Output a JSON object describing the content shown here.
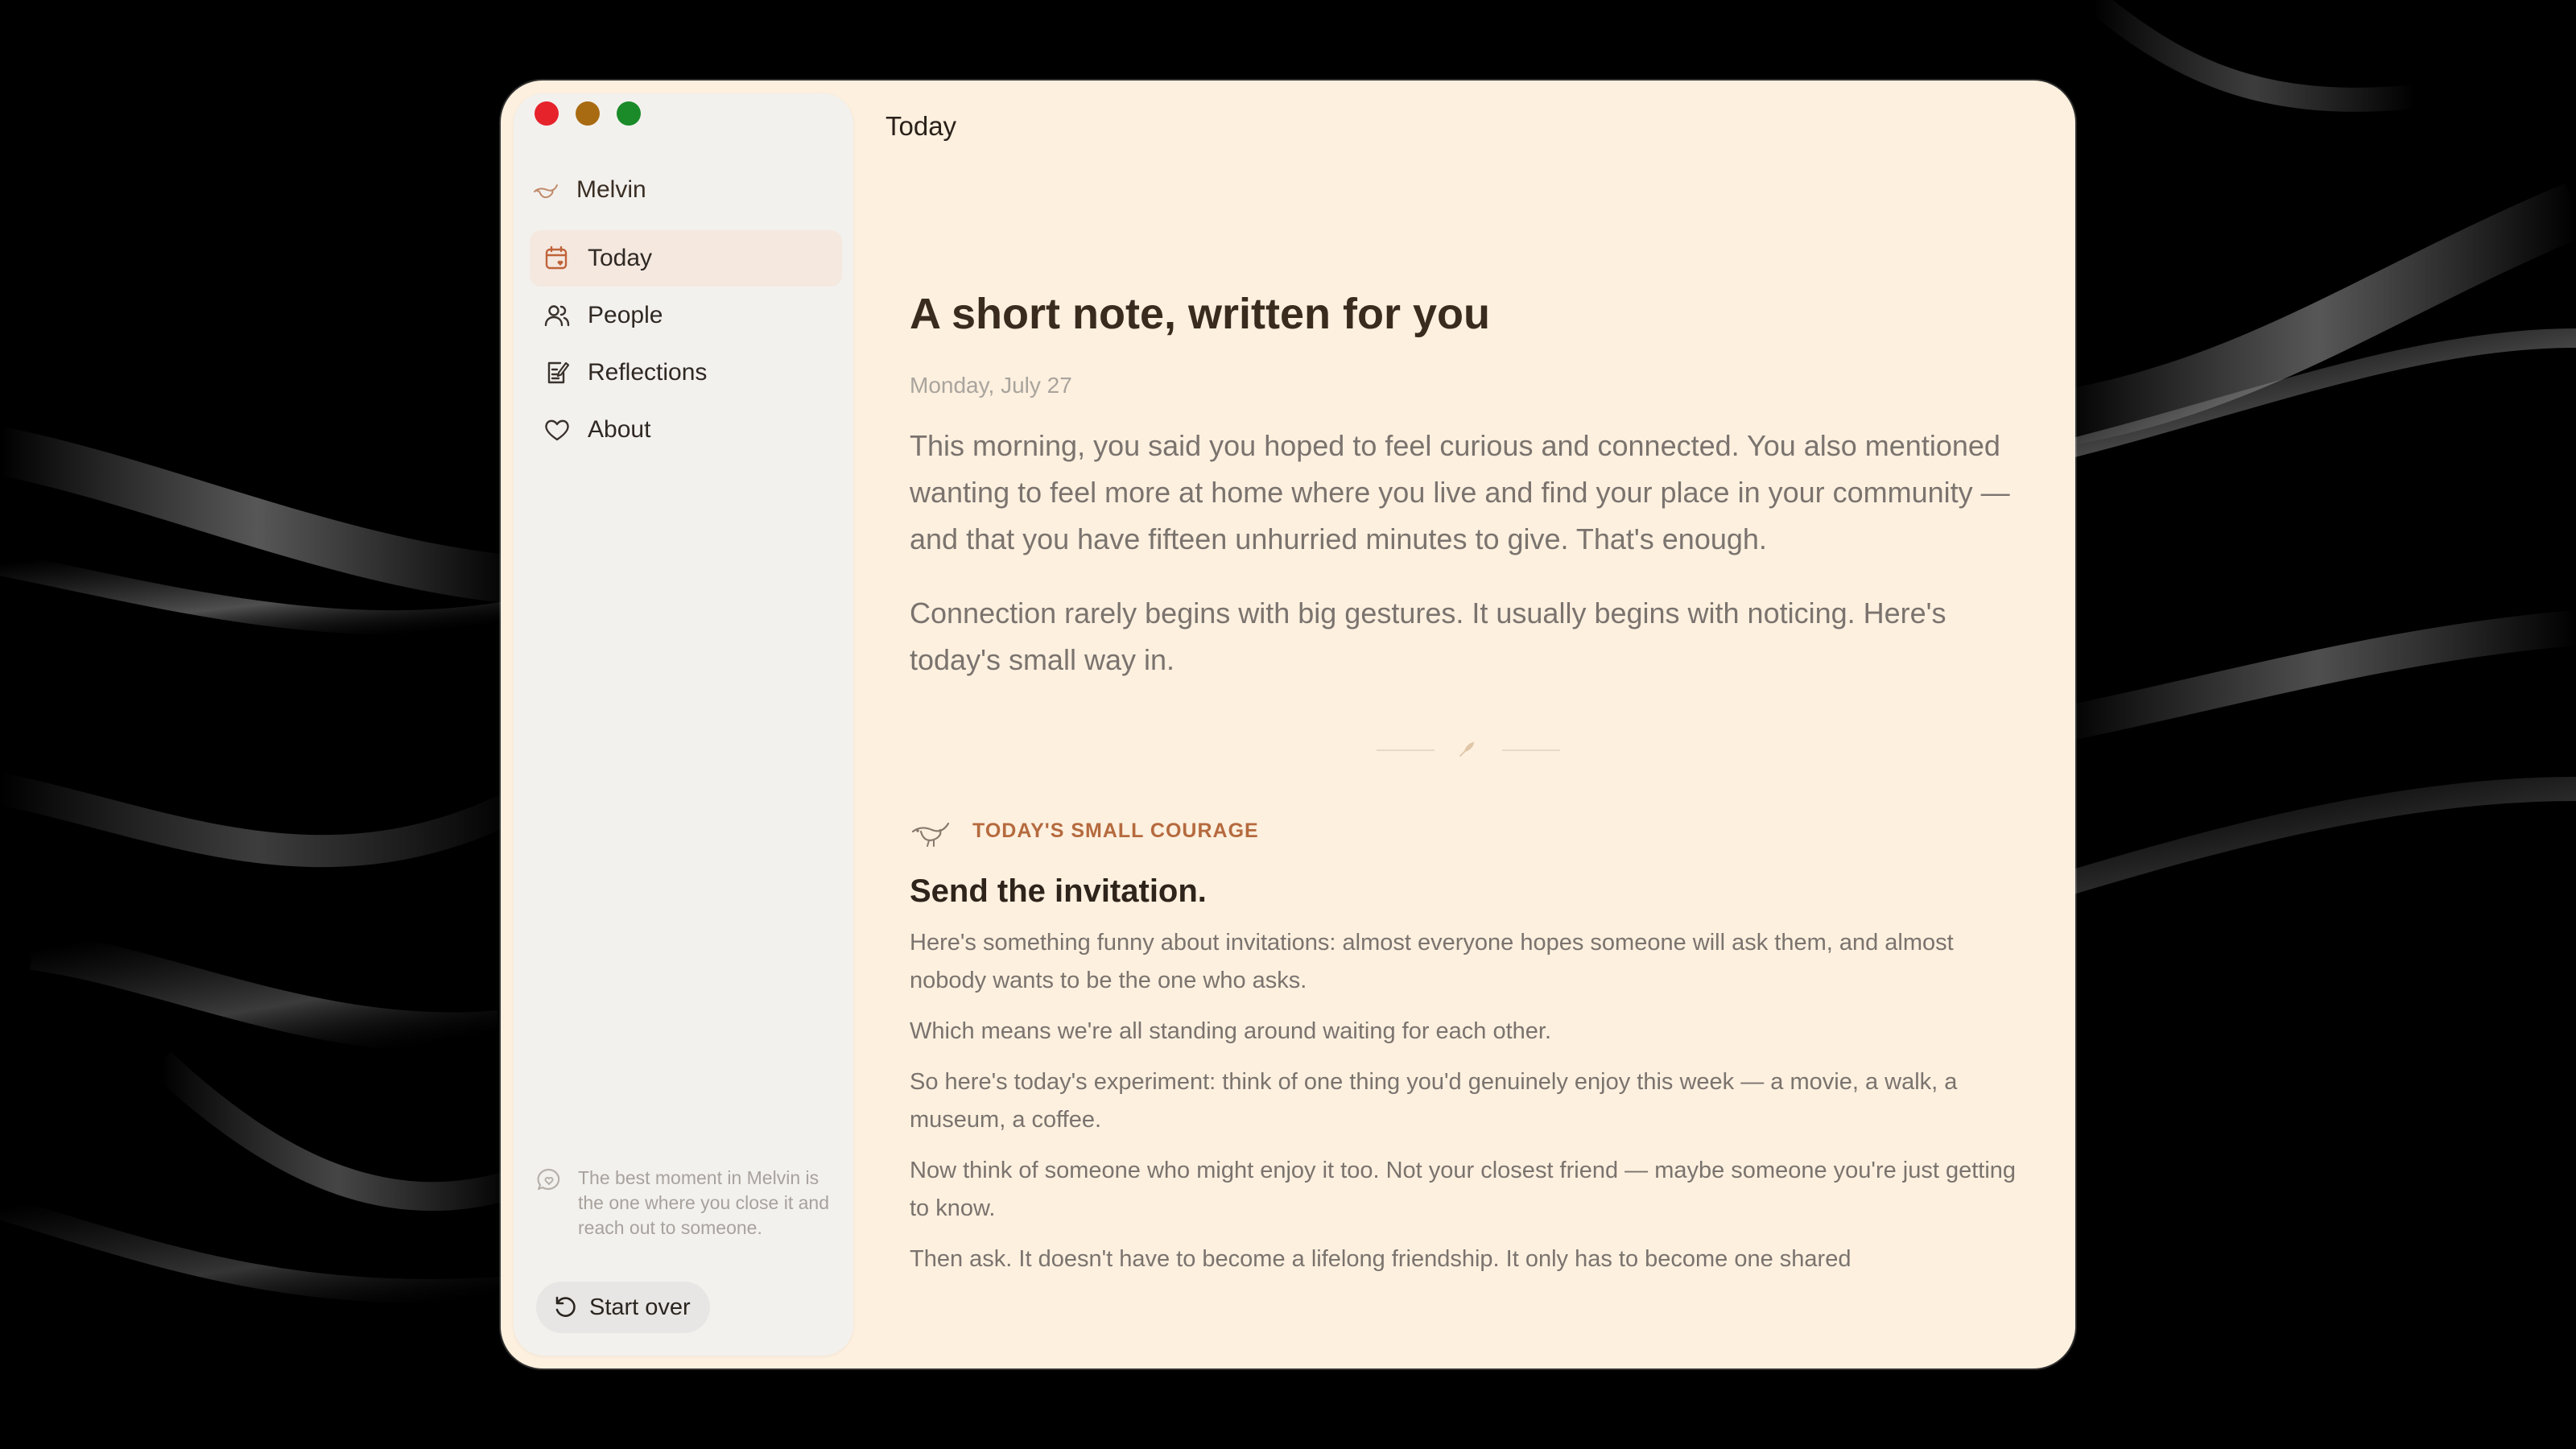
{
  "window": {
    "header_title": "Today"
  },
  "sidebar": {
    "app_name": "Melvin",
    "items": [
      {
        "label": "Today",
        "icon": "calendar-icon",
        "active": true
      },
      {
        "label": "People",
        "icon": "people-icon",
        "active": false
      },
      {
        "label": "Reflections",
        "icon": "journal-icon",
        "active": false
      },
      {
        "label": "About",
        "icon": "heart-icon",
        "active": false
      }
    ],
    "tip": "The best moment in Melvin is the one where you close it and reach out to someone.",
    "start_over_label": "Start over"
  },
  "main": {
    "title": "A short note, written for you",
    "date": "Monday, July 27",
    "intro": [
      "This morning, you said you hoped to feel curious and connected. You also mentioned wanting to feel more at home where you live and find your place in your community — and that you have fifteen unhurried minutes to give. That's enough.",
      "Connection rarely begins with big gestures. It usually begins with noticing. Here's today's small way in."
    ],
    "section_label": "TODAY'S SMALL COURAGE",
    "section_title": "Send the invitation.",
    "paragraphs": [
      "Here's something funny about invitations: almost everyone hopes someone will ask them, and almost nobody wants to be the one who asks.",
      "Which means we're all standing around waiting for each other.",
      "So here's today's experiment: think of one thing you'd genuinely enjoy this week — a movie, a walk, a museum, a coffee.",
      "Now think of someone who might enjoy it too. Not your closest friend — maybe someone you're just getting to know.",
      "Then ask. It doesn't have to become a lifelong friendship. It only has to become one shared"
    ]
  },
  "colors": {
    "accent": "#b56a3e",
    "window_bg": "#fdf0df",
    "sidebar_bg": "#f3f1ee",
    "active_item_bg": "#f4e8df"
  }
}
